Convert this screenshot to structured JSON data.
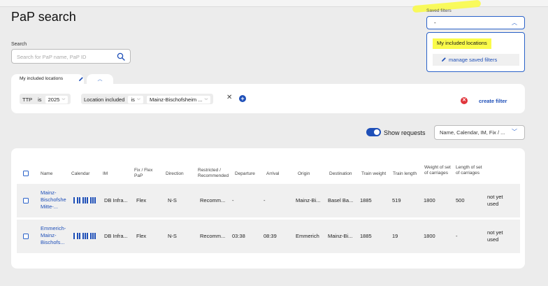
{
  "page": {
    "title": "PaP search"
  },
  "search": {
    "label": "Search",
    "placeholder": "Search for PaP name, PaP ID"
  },
  "saved_filters": {
    "label": "Saved filters",
    "selected": "-",
    "options": [
      "My included locations"
    ],
    "manage_label": "manage saved filters"
  },
  "filter_tab": {
    "label": "My included locations"
  },
  "filters": {
    "ttp": {
      "field": "TTP",
      "operator": "is",
      "value": "2025"
    },
    "location": {
      "field": "Location included",
      "operator": "is",
      "value": "Mainz-Bischofsheim ..."
    },
    "create_label": "create filter"
  },
  "toolbar": {
    "show_requests_label": "Show requests",
    "show_requests_on": true,
    "columns_select": "Name, Calendar, IM, Fix / ..."
  },
  "table": {
    "headers": [
      "Name",
      "Calendar",
      "IM",
      "Fix / Flex PaP",
      "Direction",
      "Restricted / Recommended",
      "Departure",
      "Arrival",
      "Origin",
      "Destination",
      "Train weight",
      "Train length",
      "Weight of set of carriages",
      "Length of set of carriages"
    ],
    "rows": [
      {
        "name": [
          "Mainz-",
          "Bischofshe",
          "Mitte-..."
        ],
        "im": "DB Infra...",
        "fix_flex": "Flex",
        "direction": "N-S",
        "restricted": "Recomm...",
        "departure": "-",
        "arrival": "-",
        "origin": "Mainz-Bi...",
        "destination": "Basel Ba...",
        "train_weight": "1885",
        "train_length": "519",
        "weight_set": "1800",
        "length_set": "500",
        "status": [
          "not yet",
          "used"
        ]
      },
      {
        "name": [
          "Emmerich-",
          "Mainz-",
          "Bischofs..."
        ],
        "im": "DB Infra...",
        "fix_flex": "Flex",
        "direction": "N-S",
        "restricted": "Recomm...",
        "departure": "03:38",
        "arrival": "08:39",
        "origin": "Emmerich",
        "destination": "Mainz-Bi...",
        "train_weight": "1885",
        "train_length": "19",
        "weight_set": "1800",
        "length_set": "-",
        "status": [
          "not yet",
          "used"
        ]
      }
    ]
  },
  "colors": {
    "accent": "#1e4fb8",
    "highlight": "#fafb4a",
    "danger": "#e0343a"
  }
}
